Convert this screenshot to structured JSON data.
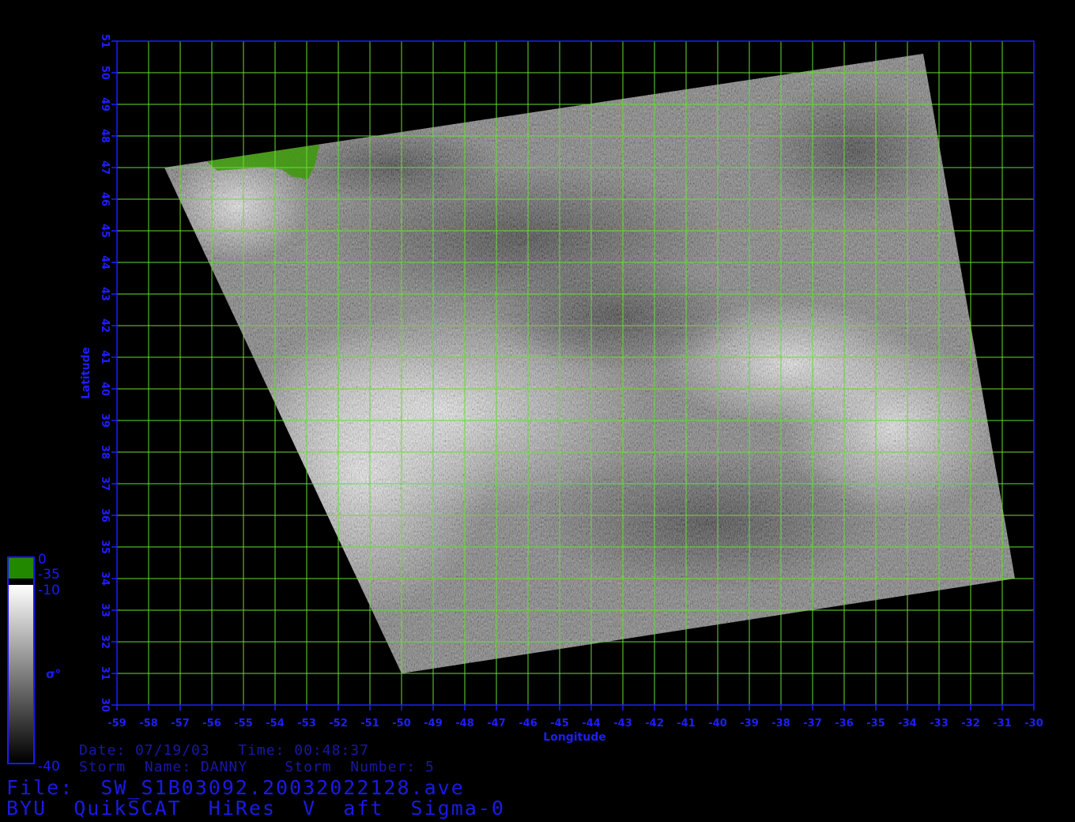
{
  "map": {
    "x_label": "Longitude",
    "y_label": "Latitude",
    "lon_min": -59,
    "lon_max": -30,
    "lat_min": 30,
    "lat_max": 51,
    "lon_ticks": [
      "-59",
      "-58",
      "-57",
      "-56",
      "-55",
      "-54",
      "-53",
      "-52",
      "-51",
      "-50",
      "-49",
      "-48",
      "-47",
      "-46",
      "-45",
      "-44",
      "-43",
      "-42",
      "-41",
      "-40",
      "-39",
      "-38",
      "-37",
      "-36",
      "-35",
      "-34",
      "-33",
      "-32",
      "-31",
      "-30"
    ],
    "lat_ticks": [
      "30",
      "31",
      "32",
      "33",
      "34",
      "35",
      "36",
      "37",
      "38",
      "39",
      "40",
      "41",
      "42",
      "43",
      "44",
      "45",
      "46",
      "47",
      "48",
      "49",
      "50",
      "51"
    ],
    "grid": true,
    "grid_color": "#66dd33",
    "axis_color": "#1e1eff",
    "swath_corners_lonlat": [
      [
        -57.5,
        47.0
      ],
      [
        -33.5,
        50.6
      ],
      [
        -30.6,
        34.0
      ],
      [
        -50.0,
        31.0
      ]
    ],
    "land_color": "#3c9a08"
  },
  "colorbar": {
    "label": "σ°",
    "top_label": "0",
    "land_label": "-35",
    "upper_label": "-10",
    "bottom_label": "-40",
    "land_color": "#228800",
    "gradient_top": "#ffffff",
    "gradient_bottom": "#000000",
    "frame_color": "#1a1aff"
  },
  "info": {
    "date_line": "Date: 07/19/03   Time: 00:48:37",
    "storm_line": "Storm  Name: DANNY    Storm  Number: 5",
    "file_line": "File:  SW_S1B03092.20032022128.ave",
    "product_line": "BYU  QuikSCAT  HiRes  V  aft  Sigma-0"
  }
}
